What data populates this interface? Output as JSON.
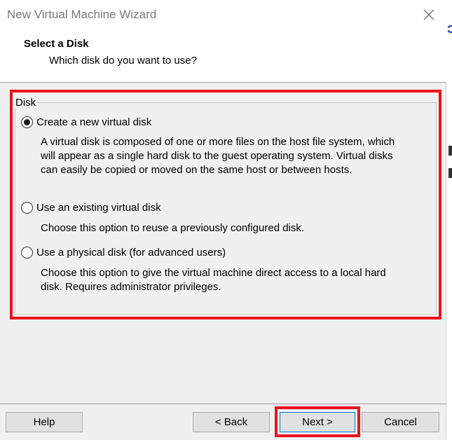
{
  "window": {
    "title": "New Virtual Machine Wizard"
  },
  "header": {
    "title": "Select a Disk",
    "subtitle": "Which disk do you want to use?"
  },
  "disk_group": {
    "label": "Disk",
    "options": [
      {
        "label": "Create a new virtual disk",
        "selected": true,
        "description_lines": [
          "A virtual disk is composed of one or more files on the host file system, which",
          "will appear as a single hard disk to the guest operating system. Virtual disks",
          "can easily be copied or moved on the same host or between hosts."
        ]
      },
      {
        "label": "Use an existing virtual disk",
        "selected": false,
        "description_lines": [
          "Choose this option to reuse a previously configured disk."
        ]
      },
      {
        "label": "Use a physical disk (for advanced users)",
        "selected": false,
        "description_lines": [
          "Choose this option to give the virtual machine direct access to a local hard",
          "disk. Requires administrator privileges."
        ]
      }
    ]
  },
  "buttons": {
    "help": "Help",
    "back": "< Back",
    "next": "Next >",
    "cancel": "Cancel"
  },
  "colors": {
    "highlight": "#e8141e",
    "dialog_bg": "#f0f0f0"
  },
  "icons": {
    "close": "close-icon"
  }
}
